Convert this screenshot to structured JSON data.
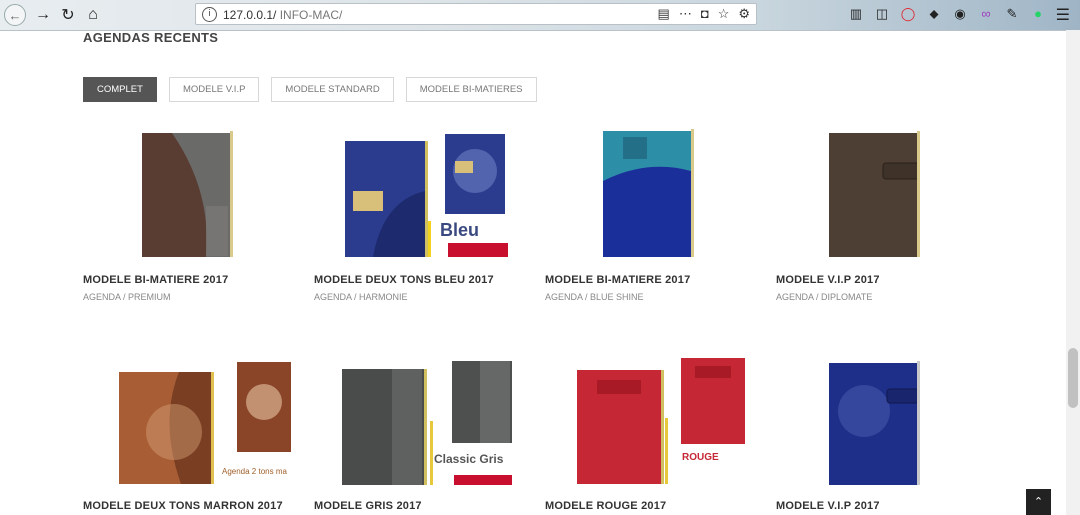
{
  "browser": {
    "url_host": "127.0.0.1/",
    "url_path": " INFO-MAC/"
  },
  "section": {
    "title": "AGENDAS RECENTS"
  },
  "filters": [
    {
      "label": "COMPLET",
      "active": true
    },
    {
      "label": "MODELE V.I.P",
      "active": false
    },
    {
      "label": "MODELE STANDARD",
      "active": false
    },
    {
      "label": "MODELE BI-MATIERES",
      "active": false
    }
  ],
  "products": [
    {
      "title": "MODELE BI-MATIERE 2017",
      "category": "AGENDA / PREMIUM"
    },
    {
      "title": "MODELE DEUX TONS BLEU 2017",
      "category": "AGENDA / HARMONIE",
      "image_caption": "Bleu"
    },
    {
      "title": "MODELE BI-MATIERE 2017",
      "category": "AGENDA / BLUE SHINE"
    },
    {
      "title": "MODELE V.I.P 2017",
      "category": "AGENDA / DIPLOMATE"
    },
    {
      "title": "MODELE DEUX TONS MARRON 2017",
      "image_caption": "Agenda 2 tons ma"
    },
    {
      "title": "MODELE GRIS 2017",
      "image_caption": "Classic Gris"
    },
    {
      "title": "MODELE ROUGE 2017",
      "image_caption": "ROUGE"
    },
    {
      "title": "MODELE V.I.P 2017"
    }
  ],
  "colors": {
    "accent_dark": "#555555",
    "brand_red": "#c8102e"
  }
}
